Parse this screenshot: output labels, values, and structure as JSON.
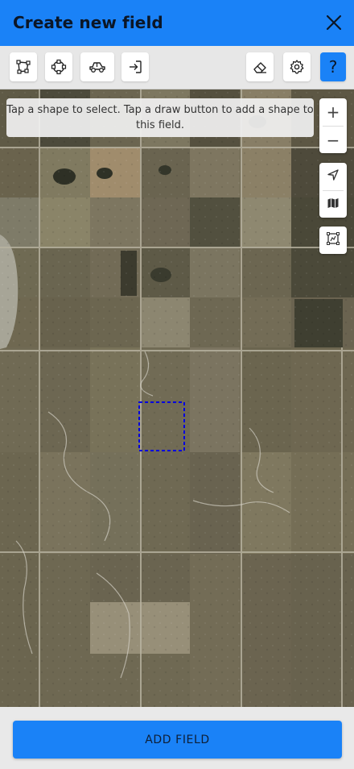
{
  "header": {
    "title": "Create new field",
    "close_icon": "close-icon"
  },
  "toolbar": {
    "tools": [
      {
        "icon": "polygon-draw-icon"
      },
      {
        "icon": "circle-draw-icon"
      },
      {
        "icon": "vehicle-drive-icon"
      },
      {
        "icon": "import-icon"
      }
    ],
    "right_tools": [
      {
        "icon": "eraser-icon"
      },
      {
        "icon": "settings-icon"
      },
      {
        "icon": "help-icon",
        "label": "?"
      }
    ]
  },
  "map": {
    "hint_text": "Tap a shape to select. Tap a draw button to add a shape to this field.",
    "zoom_in_label": "+",
    "zoom_out_label": "−",
    "controls": [
      {
        "icon": "locate-icon"
      },
      {
        "icon": "map-layers-icon"
      },
      {
        "icon": "select-area-icon"
      }
    ]
  },
  "footer": {
    "add_button_label": "ADD FIELD"
  },
  "colors": {
    "accent": "#1a82f7",
    "toolbar_bg": "#e7e7e7",
    "selection_outline": "#0000dd"
  }
}
